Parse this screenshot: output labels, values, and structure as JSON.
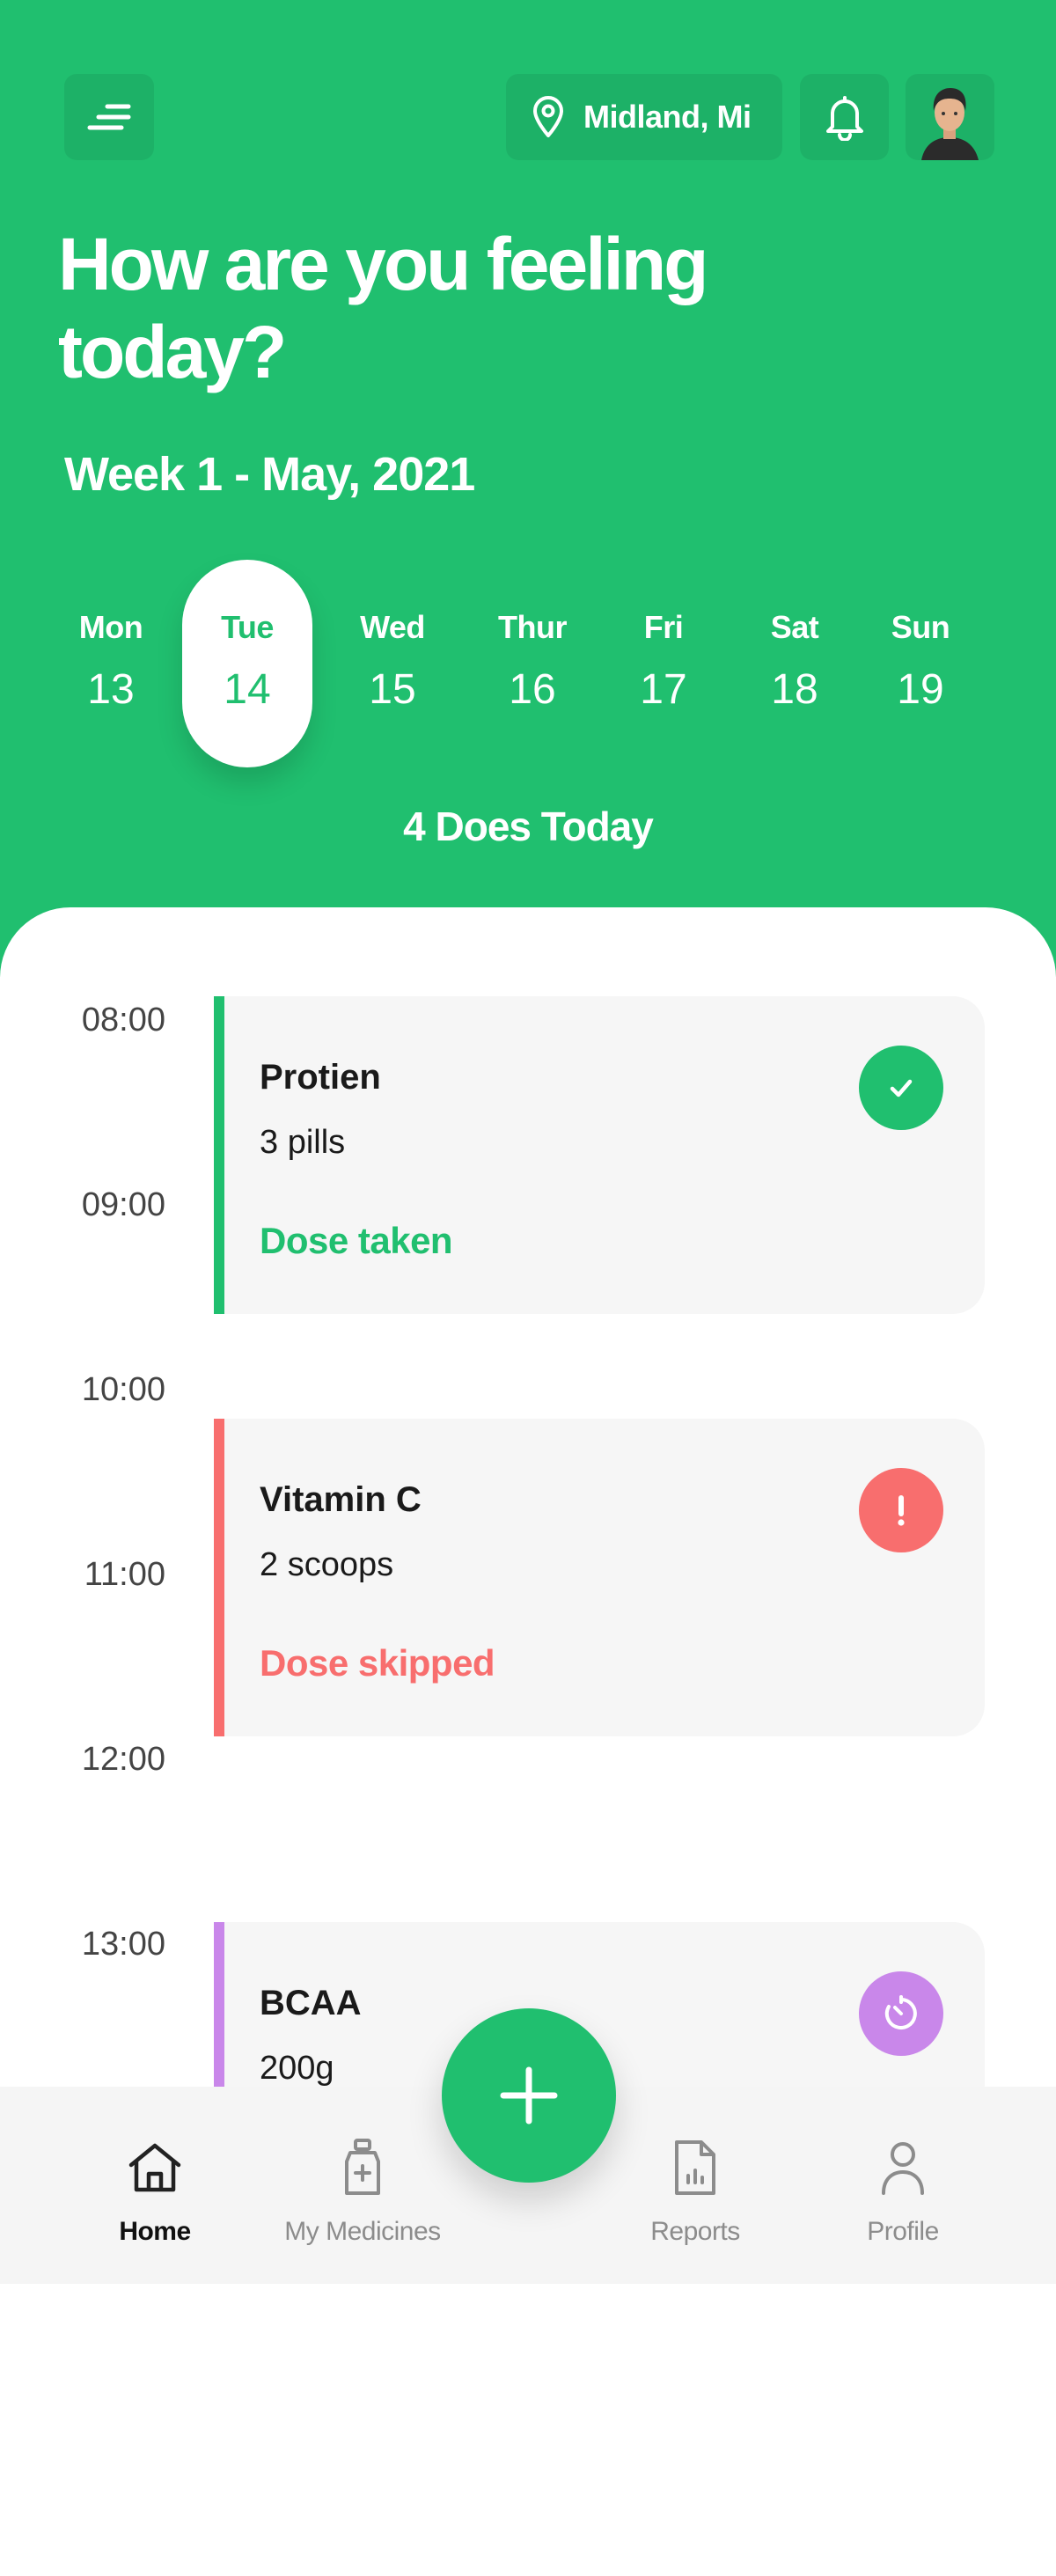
{
  "header": {
    "location": "Midland, Mi",
    "greeting": "How are you feeling today?",
    "week_label": "Week 1 - May, 2021"
  },
  "days": [
    {
      "name": "Mon",
      "num": "13",
      "active": false
    },
    {
      "name": "Tue",
      "num": "14",
      "active": true
    },
    {
      "name": "Wed",
      "num": "15",
      "active": false
    },
    {
      "name": "Thur",
      "num": "16",
      "active": false
    },
    {
      "name": "Fri",
      "num": "17",
      "active": false
    },
    {
      "name": "Sat",
      "num": "18",
      "active": false
    },
    {
      "name": "Sun",
      "num": "19",
      "active": false
    }
  ],
  "doses_today": "4 Does Today",
  "times": [
    "08:00",
    "09:00",
    "10:00",
    "11:00",
    "12:00",
    "13:00"
  ],
  "doses": [
    {
      "name": "Protien",
      "qty": "3 pills",
      "status": "Dose taken",
      "color": "#20bf6f",
      "icon": "check-icon"
    },
    {
      "name": "Vitamin C",
      "qty": "2 scoops",
      "status": "Dose skipped",
      "color": "#f86e6e",
      "icon": "exclamation-icon"
    },
    {
      "name": "BCAA",
      "qty": "200g",
      "status": "",
      "color": "#c987ea",
      "icon": "timer-icon"
    }
  ],
  "nav": [
    {
      "label": "Home",
      "icon": "home-icon",
      "active": true
    },
    {
      "label": "My Medicines",
      "icon": "medicine-bottle-icon",
      "active": false
    },
    {
      "label": "Reports",
      "icon": "report-document-icon",
      "active": false
    },
    {
      "label": "Profile",
      "icon": "profile-icon",
      "active": false
    }
  ],
  "colors": {
    "brand_green": "#20bf6f",
    "skipped_red": "#f86e6e",
    "pending_purple": "#c987ea"
  }
}
